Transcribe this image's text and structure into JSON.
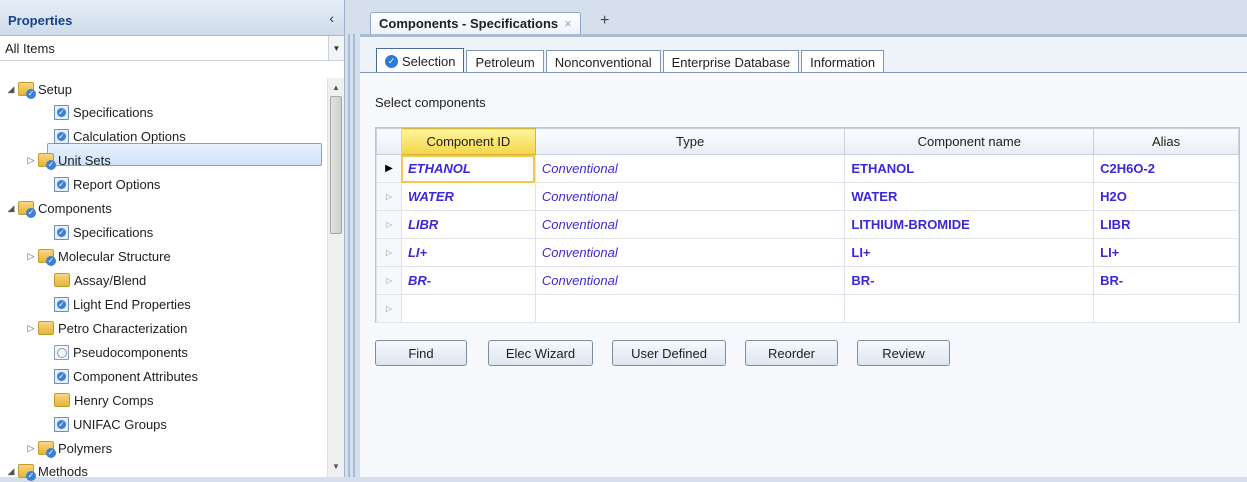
{
  "left_pane": {
    "title": "Properties",
    "collapse_glyph": "‹",
    "filter_value": "All Items",
    "tree": [
      {
        "label": "Setup",
        "icon": "folder-check-icon"
      },
      {
        "label": "Specifications",
        "icon": "form-check-icon"
      },
      {
        "label": "Calculation Options",
        "icon": "form-check-icon"
      },
      {
        "label": "Unit Sets",
        "icon": "folder-check-icon"
      },
      {
        "label": "Report Options",
        "icon": "form-check-icon"
      },
      {
        "label": "Components",
        "icon": "folder-check-icon"
      },
      {
        "label": "Specifications",
        "icon": "form-check-icon",
        "selected": true
      },
      {
        "label": "Molecular Structure",
        "icon": "folder-check-icon"
      },
      {
        "label": "Assay/Blend",
        "icon": "folder-icon"
      },
      {
        "label": "Light End Properties",
        "icon": "form-check-icon"
      },
      {
        "label": "Petro Characterization",
        "icon": "folder-icon"
      },
      {
        "label": "Pseudocomponents",
        "icon": "form-empty-icon"
      },
      {
        "label": "Component Attributes",
        "icon": "form-check-icon"
      },
      {
        "label": "Henry Comps",
        "icon": "folder-icon"
      },
      {
        "label": "UNIFAC Groups",
        "icon": "form-check-icon"
      },
      {
        "label": "Polymers",
        "icon": "folder-check-icon"
      },
      {
        "label": "Methods",
        "icon": "folder-check-icon"
      }
    ]
  },
  "document_tab": {
    "title": "Components - Specifications",
    "close_glyph": "×",
    "add_glyph": "+"
  },
  "sub_tabs": [
    "Selection",
    "Petroleum",
    "Nonconventional",
    "Enterprise Database",
    "Information"
  ],
  "active_sub_tab": "Selection",
  "selection": {
    "label": "Select components",
    "columns": [
      "Component ID",
      "Type",
      "Component name",
      "Alias"
    ],
    "rows": [
      {
        "id": "ETHANOL",
        "type": "Conventional",
        "name": "ETHANOL",
        "alias": "C2H6O-2"
      },
      {
        "id": "WATER",
        "type": "Conventional",
        "name": "WATER",
        "alias": "H2O"
      },
      {
        "id": "LIBR",
        "type": "Conventional",
        "name": "LITHIUM-BROMIDE",
        "alias": "LIBR"
      },
      {
        "id": "LI+",
        "type": "Conventional",
        "name": "LI+",
        "alias": "LI+"
      },
      {
        "id": "BR-",
        "type": "Conventional",
        "name": "BR-",
        "alias": "BR-"
      },
      {
        "id": "",
        "type": "",
        "name": "",
        "alias": ""
      }
    ],
    "current_row_glyph": "▶",
    "row_glyph": "▷"
  },
  "buttons": {
    "find": "Find",
    "elec_wizard": "Elec Wizard",
    "user_defined": "User Defined",
    "reorder": "Reorder",
    "review": "Review"
  }
}
